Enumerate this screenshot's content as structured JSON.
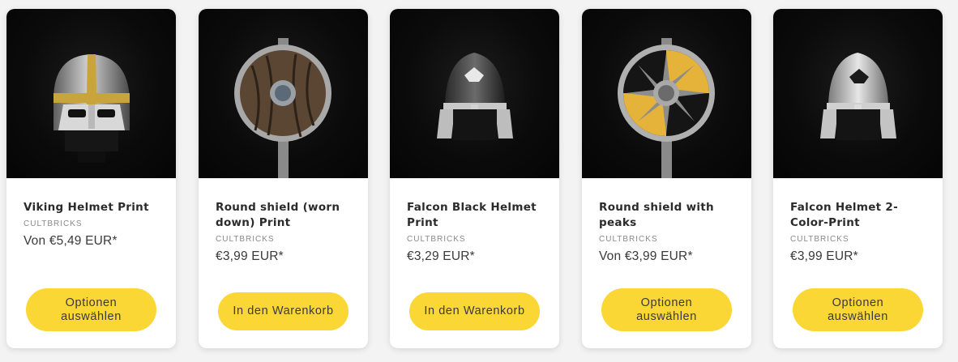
{
  "accent_color": "#fbd736",
  "products": [
    {
      "title": "Viking Helmet Print",
      "vendor": "CULTBRICKS",
      "price": "Von €5,49 EUR*",
      "button_label": "Optionen auswählen",
      "image_icon": "viking-helmet-icon"
    },
    {
      "title": "Round shield (worn down) Print",
      "vendor": "CULTBRICKS",
      "price": "€3,99 EUR*",
      "button_label": "In den Warenkorb",
      "image_icon": "wooden-round-shield-icon"
    },
    {
      "title": "Falcon Black Helmet Print",
      "vendor": "CULTBRICKS",
      "price": "€3,29 EUR*",
      "button_label": "In den Warenkorb",
      "image_icon": "falcon-black-helmet-icon"
    },
    {
      "title": "Round shield with peaks",
      "vendor": "CULTBRICKS",
      "price": "Von €3,99 EUR*",
      "button_label": "Optionen auswählen",
      "image_icon": "peaked-round-shield-icon"
    },
    {
      "title": "Falcon Helmet 2-Color-Print",
      "vendor": "CULTBRICKS",
      "price": "€3,99 EUR*",
      "button_label": "Optionen auswählen",
      "image_icon": "falcon-silver-helmet-icon"
    }
  ]
}
